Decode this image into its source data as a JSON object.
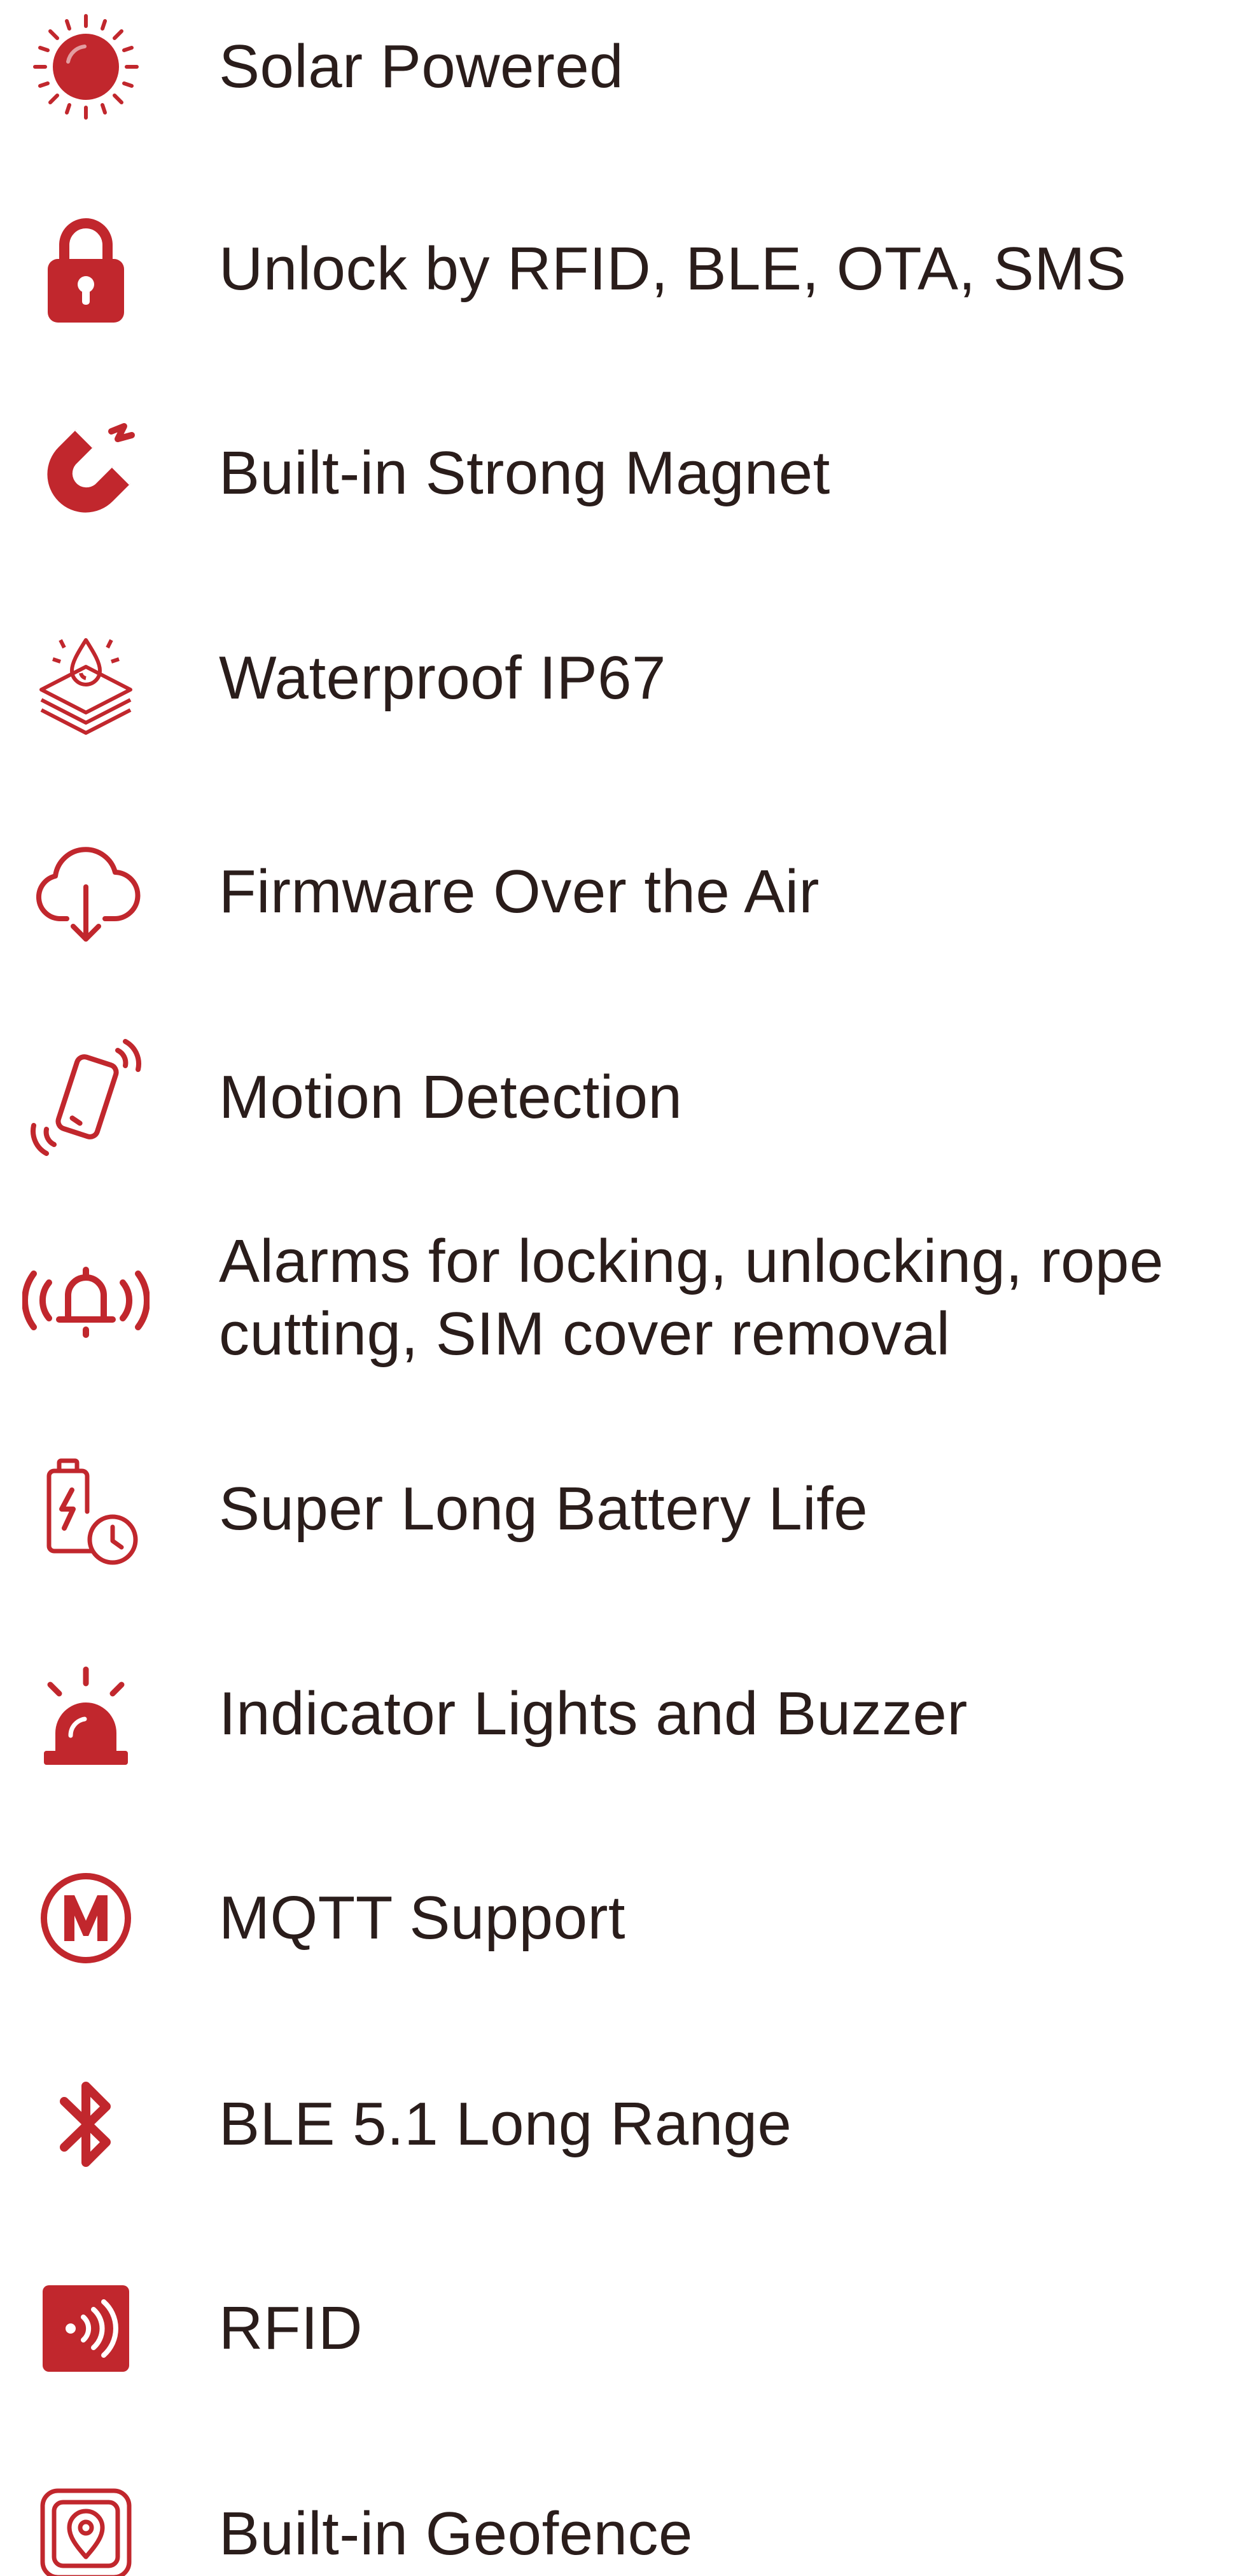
{
  "accent_color": "#c1272d",
  "text_color": "#2a1d1b",
  "features": [
    {
      "icon": "sun-icon",
      "label": "Solar Powered"
    },
    {
      "icon": "padlock-icon",
      "label": "Unlock by RFID, BLE, OTA, SMS"
    },
    {
      "icon": "magnet-icon",
      "label": "Built-in Strong Magnet"
    },
    {
      "icon": "waterproof-layers-icon",
      "label": "Waterproof IP67"
    },
    {
      "icon": "cloud-download-icon",
      "label": "Firmware Over the Air"
    },
    {
      "icon": "phone-vibration-icon",
      "label": "Motion Detection"
    },
    {
      "icon": "bell-alarm-icon",
      "label": "Alarms for locking, unlocking, rope\ncutting, SIM cover removal"
    },
    {
      "icon": "battery-clock-icon",
      "label": "Super Long Battery Life"
    },
    {
      "icon": "siren-light-icon",
      "label": "Indicator Lights and Buzzer"
    },
    {
      "icon": "mqtt-m-icon",
      "label": "MQTT Support"
    },
    {
      "icon": "bluetooth-icon",
      "label": "BLE 5.1 Long Range"
    },
    {
      "icon": "rfid-icon",
      "label": "RFID"
    },
    {
      "icon": "geofence-pin-icon",
      "label": "Built-in Geofence"
    }
  ]
}
